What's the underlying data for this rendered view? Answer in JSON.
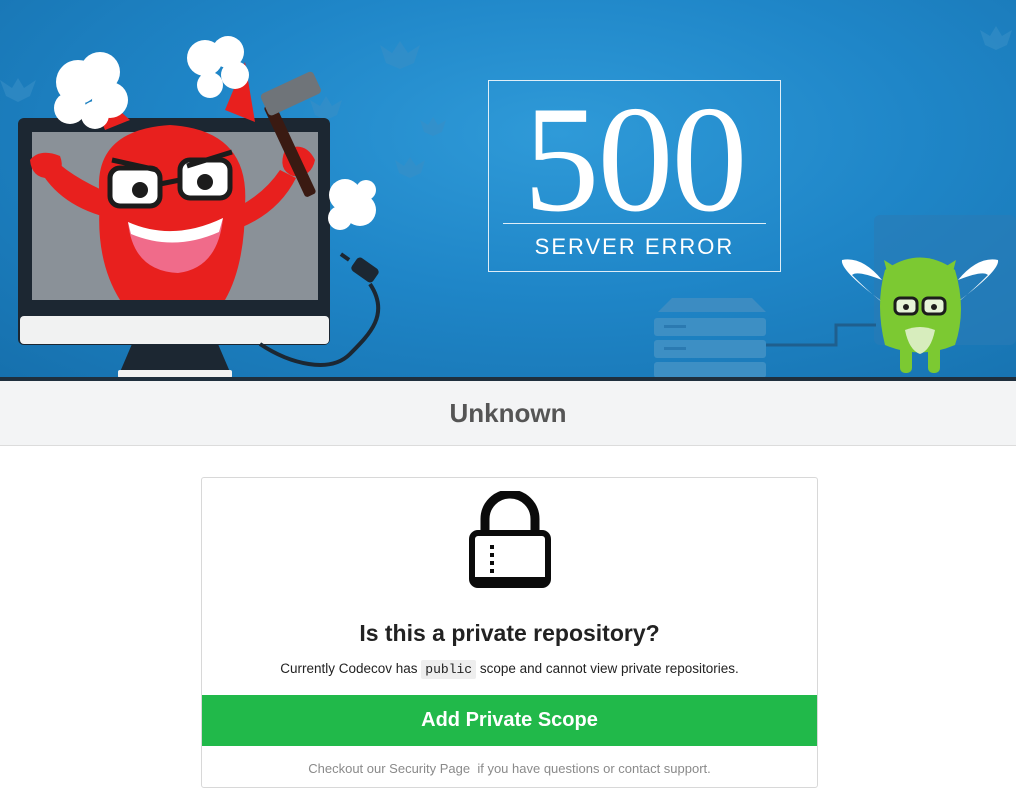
{
  "hero": {
    "error_code": "500",
    "error_text": "SERVER ERROR",
    "colors": {
      "background": "#1f86c8",
      "devil": "#e8201e",
      "monster": "#7cc932"
    }
  },
  "page": {
    "title": "Unknown"
  },
  "card": {
    "icon": "lock-icon",
    "heading": "Is this a private repository?",
    "desc_prefix": "Currently Codecov has",
    "scope_code": "public",
    "desc_suffix": "scope and cannot view private repositories.",
    "button_label": "Add Private Scope",
    "button_color": "#21b94a",
    "footer_link": "Checkout our Security Page",
    "footer_text": "if you have questions or contact support."
  }
}
